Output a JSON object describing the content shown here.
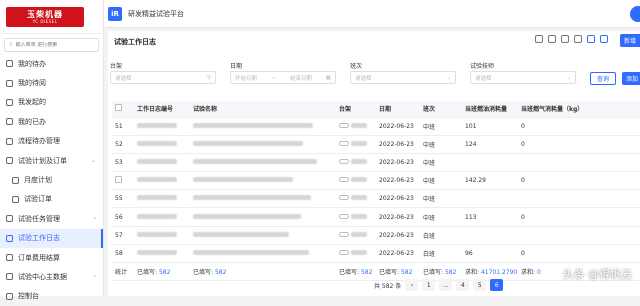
{
  "brand": {
    "logo_main": "玉柴机器",
    "logo_sub": "YC DIESEL"
  },
  "topbar": {
    "app_icon": "iR",
    "app_title": "研发精益试验平台"
  },
  "sidebar": {
    "search_placeholder": "输入菜单 进行搜索",
    "items": [
      {
        "label": "我的待办"
      },
      {
        "label": "我的待阅"
      },
      {
        "label": "我发起的"
      },
      {
        "label": "我的已办"
      },
      {
        "label": "流程待办管理"
      },
      {
        "label": "试验计划及订单"
      },
      {
        "label": "月度计划"
      },
      {
        "label": "试验订单"
      },
      {
        "label": "试验任务管理"
      },
      {
        "label": "试验工作日志"
      },
      {
        "label": "订单费用结算"
      },
      {
        "label": "试验中心主数据"
      },
      {
        "label": "控制台"
      }
    ]
  },
  "main": {
    "title": "试验工作日志",
    "new_button": "新增",
    "query_button": "查询",
    "add_button": "添加",
    "filters": {
      "bench": {
        "label": "台架",
        "placeholder": "请选择"
      },
      "date": {
        "label": "日期",
        "start": "开始日期",
        "sep": "—",
        "end": "结束日期"
      },
      "shift": {
        "label": "班次",
        "placeholder": "请选择"
      },
      "tech": {
        "label": "试验技师",
        "placeholder": "请选择"
      }
    },
    "columns": [
      "工作日志编号",
      "试验名称",
      "台架",
      "日期",
      "班次",
      "当班燃油消耗量",
      "当班燃气消耗量（kg）"
    ],
    "rows": [
      {
        "no": "51",
        "date": "2022-06-23",
        "shift": "中班",
        "fuel": "101",
        "gas": "0"
      },
      {
        "no": "52",
        "date": "2022-06-23",
        "shift": "中班",
        "fuel": "124",
        "gas": "0"
      },
      {
        "no": "53",
        "date": "2022-06-23",
        "shift": "中班",
        "fuel": "",
        "gas": ""
      },
      {
        "no": "",
        "date": "2022-06-23",
        "shift": "中班",
        "fuel": "142.29",
        "gas": "0"
      },
      {
        "no": "55",
        "date": "2022-06-23",
        "shift": "中班",
        "fuel": "",
        "gas": ""
      },
      {
        "no": "56",
        "date": "2022-06-23",
        "shift": "中班",
        "fuel": "113",
        "gas": "0"
      },
      {
        "no": "57",
        "date": "2022-06-23",
        "shift": "白班",
        "fuel": "",
        "gas": ""
      },
      {
        "no": "58",
        "date": "2022-06-23",
        "shift": "白班",
        "fuel": "96",
        "gas": "0"
      }
    ],
    "summary": {
      "label": "统计",
      "filled1_label": "已填写:",
      "filled1": "582",
      "filled2_label": "已填写:",
      "filled2": "582",
      "filled3_label": "已填写:",
      "filled3": "582",
      "filled4_label": "已填写:",
      "filled4": "582",
      "filled5_label": "已填写:",
      "filled5": "582",
      "sum1_label": "求和:",
      "sum1": "41701.2790",
      "sum2_label": "求和:",
      "sum2": "0"
    },
    "pager": {
      "total": "共 582 条",
      "pages": [
        "1",
        "...",
        "4",
        "5",
        "6"
      ],
      "active": "6",
      "prev": "‹"
    }
  },
  "watermark": "头条 @得帆云"
}
